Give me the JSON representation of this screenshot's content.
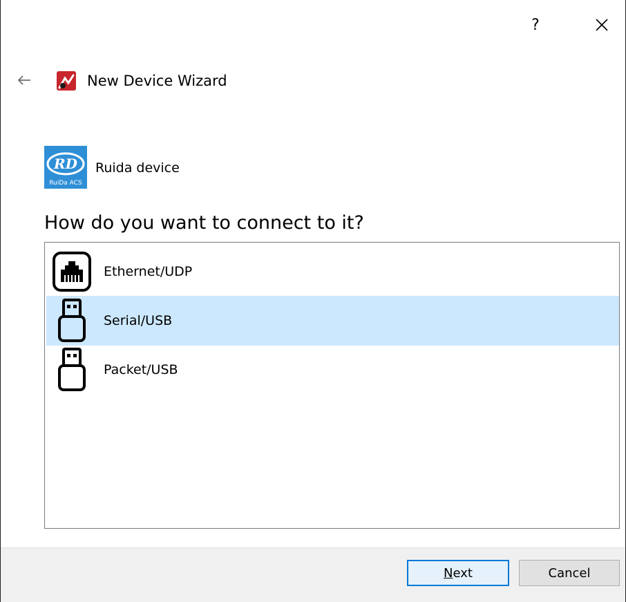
{
  "titlebar": {
    "help_label": "?",
    "close_icon": "close-icon"
  },
  "header": {
    "back_icon": "back-arrow-icon",
    "app_icon": "lightburn-app-icon",
    "title": "New Device Wizard"
  },
  "device": {
    "logo": {
      "letters": "RD",
      "caption": "RuiDa ACS",
      "color": "#2e8fd6"
    },
    "label": "Ruida device"
  },
  "question": "How do you want to connect to it?",
  "connections": [
    {
      "label": "Ethernet/UDP",
      "icon": "ethernet-port-icon",
      "selected": false
    },
    {
      "label": "Serial/USB",
      "icon": "usb-plug-icon",
      "selected": true
    },
    {
      "label": "Packet/USB",
      "icon": "usb-plug-icon",
      "selected": false
    }
  ],
  "footer": {
    "next_mnemonic": "N",
    "next_rest": "ext",
    "cancel_label": "Cancel"
  },
  "colors": {
    "selection": "#cce8ff",
    "default_button_border": "#0078d7",
    "footer_bg": "#f0f0f0"
  }
}
